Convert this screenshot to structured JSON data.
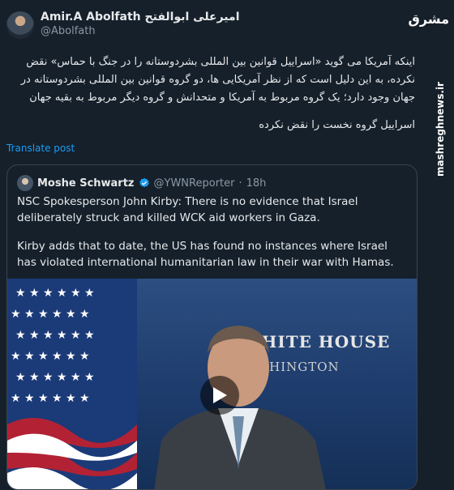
{
  "author": {
    "display_name": "Amir.A Abolfath امیرعلی ابوالفتح",
    "handle": "@Abolfath"
  },
  "post": {
    "paragraph1": "اینکه آمریکا می گوید «اسراییل قوانین بین المللی بشردوستانه را در جنگ با حماس» نقض نکرده، به این دلیل است که از نظر آمریکایی ها، دو گروه قوانین بین المللی بشردوستانه در جهان وجود دارد؛ یک گروه مربوط به آمریکا و متحدانش و گروه دیگر مربوط به بقیه جهان",
    "paragraph2": "اسراییل گروه نخست را نقض نکرده"
  },
  "translate_label": "Translate post",
  "quote": {
    "name": "Moshe Schwartz",
    "handle": "@YWNReporter",
    "separator": "·",
    "time": "18h",
    "paragraph1": "NSC Spokesperson John Kirby: There is no evidence that Israel deliberately struck and killed WCK aid workers in Gaza.",
    "paragraph2": "Kirby adds that to date, the US has found no instances where Israel has violated international humanitarian law in their war with Hamas.",
    "media": {
      "backdrop_line1": "WHITE HOUSE",
      "backdrop_line2": "ASHINGTON"
    }
  },
  "watermark": {
    "logo_text": "مشرق",
    "site": "mashreghnews.ir"
  },
  "colors": {
    "background": "#15202b",
    "link": "#1d9bf0",
    "border": "#38444d",
    "muted": "#8b98a5"
  }
}
